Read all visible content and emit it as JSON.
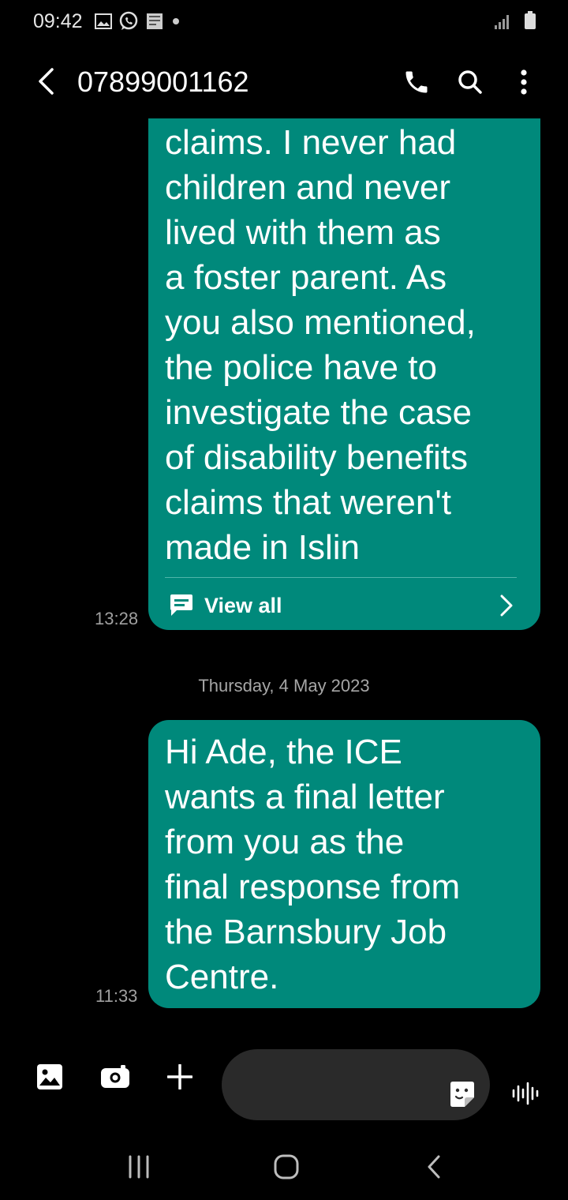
{
  "status_bar": {
    "time": "09:42",
    "notification_icons": [
      "gallery-icon",
      "whatsapp-icon",
      "app-icon",
      "dot-icon"
    ],
    "system_icons": [
      "signal-icon",
      "battery-icon"
    ]
  },
  "header": {
    "title": "07899001162",
    "actions": [
      "call-icon",
      "search-icon",
      "more-options-icon"
    ]
  },
  "messages": [
    {
      "text": "claims. I never had\nchildren and never\nlived with them as\na foster parent. As\nyou also mentioned,\nthe police have to\ninvestigate the case\nof disability benefits\nclaims that weren't\nmade in Islin",
      "time": "13:28",
      "view_all_label": "View all"
    },
    {
      "text": "Hi Ade, the ICE\nwants a final letter\nfrom you as the\nfinal response from\nthe Barnsbury Job\nCentre.",
      "time": "11:33"
    }
  ],
  "date_separator": "Thursday, 4 May 2023",
  "composer": {
    "input_value": "",
    "input_placeholder": ""
  },
  "colors": {
    "bubble": "#00897b",
    "background": "#000000",
    "input_bg": "#2a2a2a"
  }
}
